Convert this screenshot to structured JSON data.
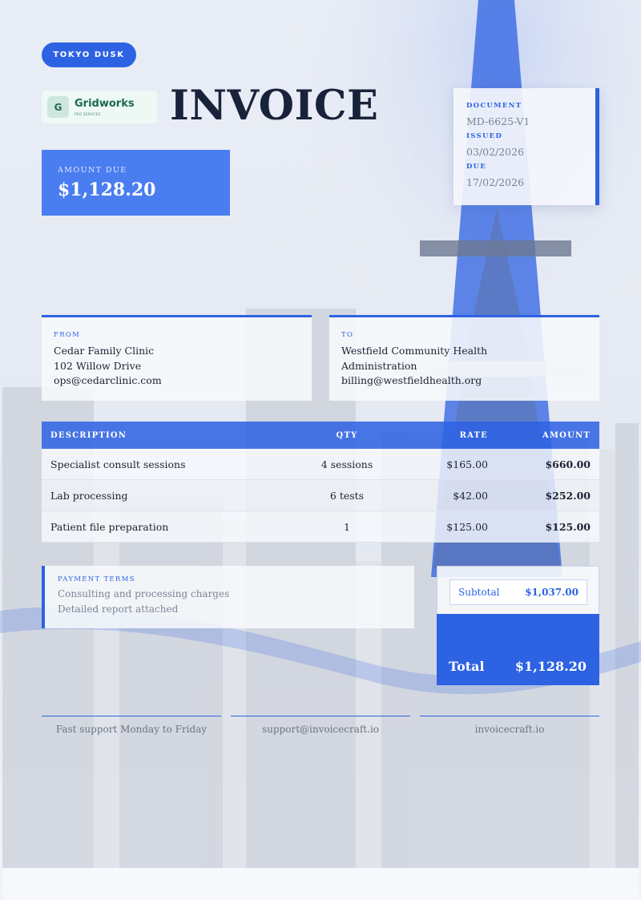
{
  "theme": {
    "accent": "#2d62e3",
    "accent_light": "#4a7df0",
    "text": "#1b2333",
    "muted": "#7c8496"
  },
  "badge": "TOKYO DUSK",
  "logo": {
    "mark": "G",
    "name": "Gridworks",
    "tagline": "PRO SERVICES"
  },
  "title": "INVOICE",
  "amount_due": {
    "label": "AMOUNT DUE",
    "value": "$1,128.20"
  },
  "document": {
    "doc_label": "DOCUMENT",
    "doc_value": "MD-6625-V1",
    "issued_label": "ISSUED",
    "issued_value": "03/02/2026",
    "due_label": "DUE",
    "due_value": "17/02/2026"
  },
  "from": {
    "label": "FROM",
    "lines": [
      "Cedar Family Clinic",
      "102 Willow Drive",
      "ops@cedarclinic.com"
    ]
  },
  "to": {
    "label": "TO",
    "lines": [
      "Westfield Community Health",
      "Administration",
      "billing@westfieldhealth.org"
    ]
  },
  "items": {
    "headers": {
      "description": "DESCRIPTION",
      "qty": "QTY",
      "rate": "RATE",
      "amount": "AMOUNT"
    },
    "rows": [
      {
        "description": "Specialist consult sessions",
        "qty": "4 sessions",
        "rate": "$165.00",
        "amount": "$660.00"
      },
      {
        "description": "Lab processing",
        "qty": "6 tests",
        "rate": "$42.00",
        "amount": "$252.00"
      },
      {
        "description": "Patient file preparation",
        "qty": "1",
        "rate": "$125.00",
        "amount": "$125.00"
      }
    ]
  },
  "terms": {
    "label": "PAYMENT TERMS",
    "lines": [
      "Consulting and processing charges",
      "Detailed report attached"
    ]
  },
  "totals": {
    "subtotal_label": "Subtotal",
    "subtotal_value": "$1,037.00",
    "total_label": "Total",
    "total_value": "$1,128.20"
  },
  "footer": [
    "Fast support Monday to Friday",
    "support@invoicecraft.io",
    "invoicecraft.io"
  ]
}
